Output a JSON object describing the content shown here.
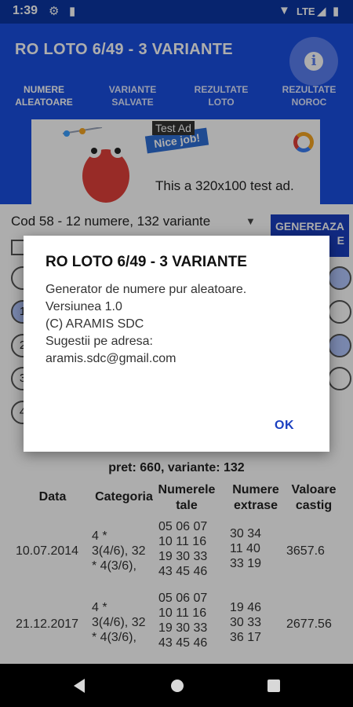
{
  "status": {
    "time": "1:39",
    "network": "LTE"
  },
  "app": {
    "title": "RO LOTO 6/49 - 3 VARIANTE"
  },
  "tabs": [
    {
      "line1": "NUMERE",
      "line2": "ALEATOARE"
    },
    {
      "line1": "VARIANTE",
      "line2": "SALVATE"
    },
    {
      "line1": "REZULTATE",
      "line2": "LOTO"
    },
    {
      "line1": "REZULTATE",
      "line2": "NOROC"
    }
  ],
  "ad": {
    "label": "Test Ad",
    "banner": "Nice job!",
    "text": "This a 320x100 test ad."
  },
  "spinner": {
    "value": "Cod 58 - 12 numere, 132 variante"
  },
  "generate_button": {
    "line1": "GENEREAZA",
    "line2": "E"
  },
  "circles_left": [
    "",
    "1",
    "2",
    "3",
    "4"
  ],
  "summary": "pret: 660, variante: 132",
  "table": {
    "headers": [
      {
        "line1": "Data",
        "line2": ""
      },
      {
        "line1": "Categoria",
        "line2": ""
      },
      {
        "line1": "Numerele",
        "line2": "tale"
      },
      {
        "line1": "Numere",
        "line2": "extrase"
      },
      {
        "line1": "Valoare",
        "line2": "castig"
      }
    ],
    "rows": [
      {
        "date": "10.07.2014",
        "category": [
          "4 *",
          "3(4/6), 32",
          "* 4(3/6),"
        ],
        "yours": [
          "05 06 07",
          "10 11 16",
          "19 30 33",
          "43 45 46"
        ],
        "drawn": [
          "30 34",
          "11 40",
          "33 19"
        ],
        "win": "3657.6"
      },
      {
        "date": "21.12.2017",
        "category": [
          "4 *",
          "3(4/6), 32",
          "* 4(3/6),"
        ],
        "yours": [
          "05 06 07",
          "10 11 16",
          "19 30 33",
          "43 45 46"
        ],
        "drawn": [
          "19 46",
          "30 33",
          "36 17"
        ],
        "win": "2677.56"
      }
    ]
  },
  "dialog": {
    "title": "RO LOTO 6/49 - 3 VARIANTE",
    "lines": [
      "Generator de numere pur aleatoare.",
      "",
      "Versiunea 1.0",
      "(C) ARAMIS SDC",
      "",
      "Sugestii pe adresa:",
      "aramis.sdc@gmail.com"
    ],
    "ok": "OK"
  },
  "colors": {
    "primary": "#1a4fe0",
    "primary_dark": "#0b36a3",
    "accent": "#1a3fc0"
  }
}
